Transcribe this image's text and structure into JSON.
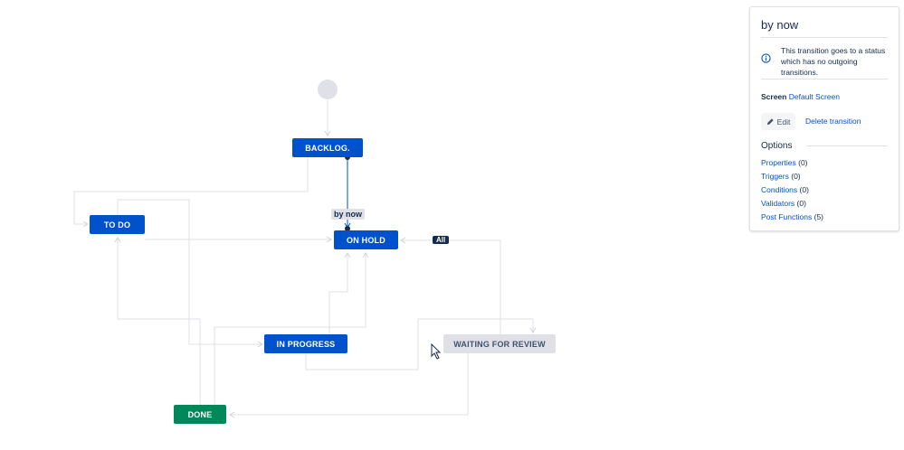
{
  "diagram": {
    "states": [
      {
        "id": "backlog",
        "label": "BACKLOG."
      },
      {
        "id": "todo",
        "label": "TO DO"
      },
      {
        "id": "onhold",
        "label": "ON HOLD"
      },
      {
        "id": "inprogress",
        "label": "IN PROGRESS"
      },
      {
        "id": "waiting",
        "label": "WAITING FOR REVIEW"
      },
      {
        "id": "done",
        "label": "DONE"
      }
    ],
    "transitions": {
      "by_now": "by now",
      "all": "All"
    }
  },
  "panel": {
    "title": "by now",
    "info_text": "This transition goes to a status which has no outgoing transitions.",
    "screen_label": "Screen",
    "screen_value": "Default Screen",
    "edit_label": "Edit",
    "delete_label": "Delete transition",
    "options_heading": "Options",
    "options": [
      {
        "label": "Properties",
        "count": "(0)"
      },
      {
        "label": "Triggers",
        "count": "(0)"
      },
      {
        "label": "Conditions",
        "count": "(0)"
      },
      {
        "label": "Validators",
        "count": "(0)"
      },
      {
        "label": "Post Functions",
        "count": "(5)"
      }
    ]
  },
  "colors": {
    "status_blue": "#0052cc",
    "status_green": "#00875a",
    "status_grey": "#dfe1e6",
    "connector": "#dfe1e6",
    "selected_transition": "#0052cc"
  },
  "icons": [
    "info-icon",
    "pencil-icon",
    "mouse-cursor-icon"
  ]
}
